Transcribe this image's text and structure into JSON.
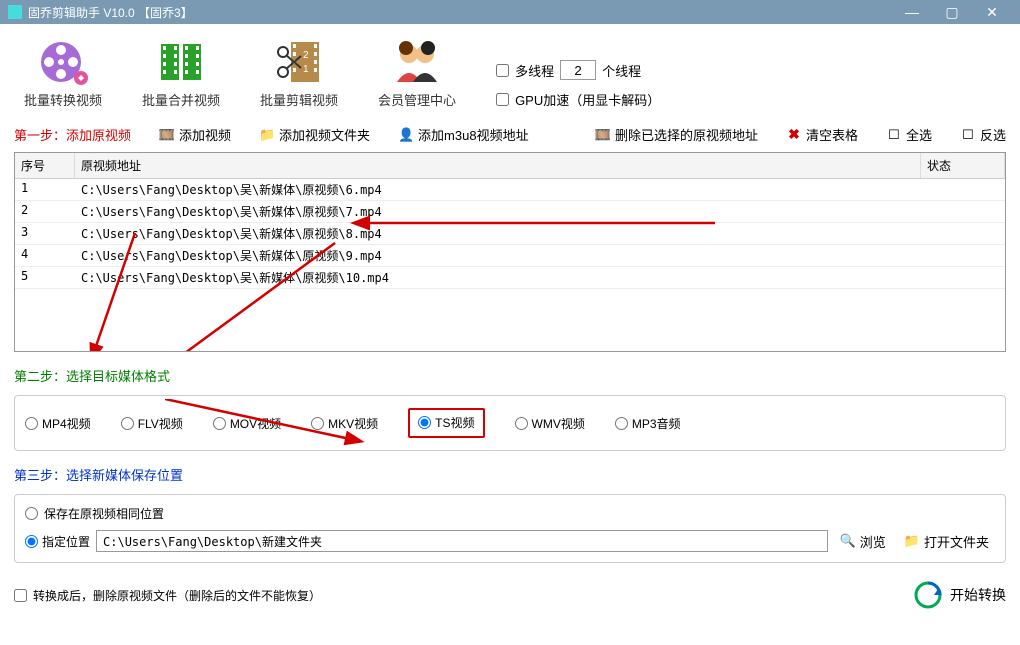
{
  "window": {
    "title": "固乔剪辑助手 V10.0   【固乔3】"
  },
  "tools": {
    "convert": "批量转换视频",
    "merge": "批量合并视频",
    "clip": "批量剪辑视频",
    "member": "会员管理中心"
  },
  "opts": {
    "multithread_label": "多线程",
    "thread_count": "2",
    "thread_suffix": "个线程",
    "gpu_label": "GPU加速（用显卡解码）"
  },
  "step1": {
    "title": "第一步：添加原视频",
    "add_video": "添加视频",
    "add_folder": "添加视频文件夹",
    "add_m3u8": "添加m3u8视频地址",
    "del_selected": "删除已选择的原视频地址",
    "clear": "清空表格",
    "select_all": "全选",
    "invert": "反选"
  },
  "grid": {
    "headers": {
      "index": "序号",
      "path": "原视频地址",
      "status": "状态"
    },
    "rows": [
      {
        "idx": "1",
        "path": "C:\\Users\\Fang\\Desktop\\吴\\新媒体\\原视频\\6.mp4"
      },
      {
        "idx": "2",
        "path": "C:\\Users\\Fang\\Desktop\\吴\\新媒体\\原视频\\7.mp4"
      },
      {
        "idx": "3",
        "path": "C:\\Users\\Fang\\Desktop\\吴\\新媒体\\原视频\\8.mp4"
      },
      {
        "idx": "4",
        "path": "C:\\Users\\Fang\\Desktop\\吴\\新媒体\\原视频\\9.mp4"
      },
      {
        "idx": "5",
        "path": "C:\\Users\\Fang\\Desktop\\吴\\新媒体\\原视频\\10.mp4"
      }
    ]
  },
  "step2": {
    "title": "第二步：选择目标媒体格式",
    "formats": {
      "mp4": "MP4视频",
      "flv": "FLV视频",
      "mov": "MOV视频",
      "mkv": "MKV视频",
      "ts": "TS视频",
      "wmv": "WMV视频",
      "mp3": "MP3音频"
    },
    "selected": "ts"
  },
  "step3": {
    "title": "第三步：选择新媒体保存位置",
    "same_loc": "保存在原视频相同位置",
    "spec_loc": "指定位置",
    "path": "C:\\Users\\Fang\\Desktop\\新建文件夹",
    "browse": "浏览",
    "open_folder": "打开文件夹"
  },
  "footer": {
    "delete_after": "转换成后，删除原视频文件（删除后的文件不能恢复）",
    "start": "开始转换"
  }
}
